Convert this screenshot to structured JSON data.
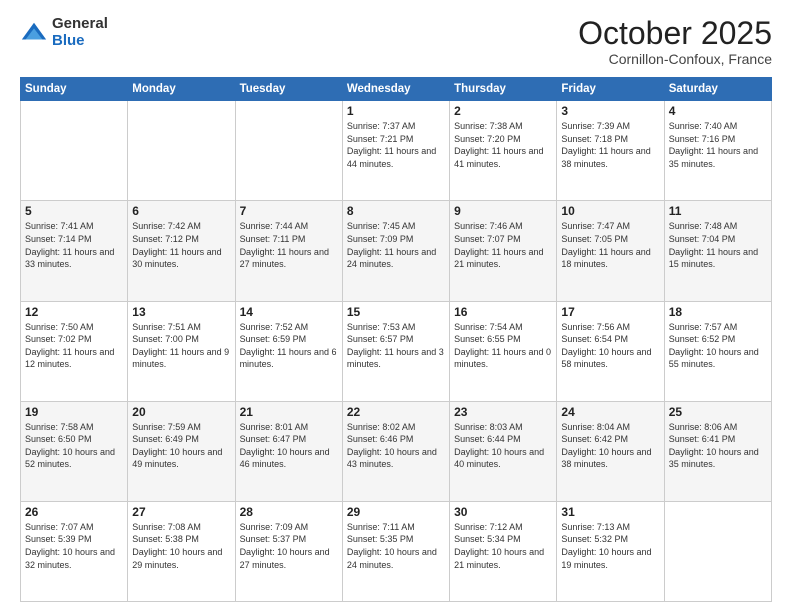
{
  "header": {
    "logo": {
      "general": "General",
      "blue": "Blue"
    },
    "title": "October 2025",
    "location": "Cornillon-Confoux, France"
  },
  "days_of_week": [
    "Sunday",
    "Monday",
    "Tuesday",
    "Wednesday",
    "Thursday",
    "Friday",
    "Saturday"
  ],
  "weeks": [
    [
      {
        "day": "",
        "sunrise": "",
        "sunset": "",
        "daylight": ""
      },
      {
        "day": "",
        "sunrise": "",
        "sunset": "",
        "daylight": ""
      },
      {
        "day": "",
        "sunrise": "",
        "sunset": "",
        "daylight": ""
      },
      {
        "day": "1",
        "sunrise": "Sunrise: 7:37 AM",
        "sunset": "Sunset: 7:21 PM",
        "daylight": "Daylight: 11 hours and 44 minutes."
      },
      {
        "day": "2",
        "sunrise": "Sunrise: 7:38 AM",
        "sunset": "Sunset: 7:20 PM",
        "daylight": "Daylight: 11 hours and 41 minutes."
      },
      {
        "day": "3",
        "sunrise": "Sunrise: 7:39 AM",
        "sunset": "Sunset: 7:18 PM",
        "daylight": "Daylight: 11 hours and 38 minutes."
      },
      {
        "day": "4",
        "sunrise": "Sunrise: 7:40 AM",
        "sunset": "Sunset: 7:16 PM",
        "daylight": "Daylight: 11 hours and 35 minutes."
      }
    ],
    [
      {
        "day": "5",
        "sunrise": "Sunrise: 7:41 AM",
        "sunset": "Sunset: 7:14 PM",
        "daylight": "Daylight: 11 hours and 33 minutes."
      },
      {
        "day": "6",
        "sunrise": "Sunrise: 7:42 AM",
        "sunset": "Sunset: 7:12 PM",
        "daylight": "Daylight: 11 hours and 30 minutes."
      },
      {
        "day": "7",
        "sunrise": "Sunrise: 7:44 AM",
        "sunset": "Sunset: 7:11 PM",
        "daylight": "Daylight: 11 hours and 27 minutes."
      },
      {
        "day": "8",
        "sunrise": "Sunrise: 7:45 AM",
        "sunset": "Sunset: 7:09 PM",
        "daylight": "Daylight: 11 hours and 24 minutes."
      },
      {
        "day": "9",
        "sunrise": "Sunrise: 7:46 AM",
        "sunset": "Sunset: 7:07 PM",
        "daylight": "Daylight: 11 hours and 21 minutes."
      },
      {
        "day": "10",
        "sunrise": "Sunrise: 7:47 AM",
        "sunset": "Sunset: 7:05 PM",
        "daylight": "Daylight: 11 hours and 18 minutes."
      },
      {
        "day": "11",
        "sunrise": "Sunrise: 7:48 AM",
        "sunset": "Sunset: 7:04 PM",
        "daylight": "Daylight: 11 hours and 15 minutes."
      }
    ],
    [
      {
        "day": "12",
        "sunrise": "Sunrise: 7:50 AM",
        "sunset": "Sunset: 7:02 PM",
        "daylight": "Daylight: 11 hours and 12 minutes."
      },
      {
        "day": "13",
        "sunrise": "Sunrise: 7:51 AM",
        "sunset": "Sunset: 7:00 PM",
        "daylight": "Daylight: 11 hours and 9 minutes."
      },
      {
        "day": "14",
        "sunrise": "Sunrise: 7:52 AM",
        "sunset": "Sunset: 6:59 PM",
        "daylight": "Daylight: 11 hours and 6 minutes."
      },
      {
        "day": "15",
        "sunrise": "Sunrise: 7:53 AM",
        "sunset": "Sunset: 6:57 PM",
        "daylight": "Daylight: 11 hours and 3 minutes."
      },
      {
        "day": "16",
        "sunrise": "Sunrise: 7:54 AM",
        "sunset": "Sunset: 6:55 PM",
        "daylight": "Daylight: 11 hours and 0 minutes."
      },
      {
        "day": "17",
        "sunrise": "Sunrise: 7:56 AM",
        "sunset": "Sunset: 6:54 PM",
        "daylight": "Daylight: 10 hours and 58 minutes."
      },
      {
        "day": "18",
        "sunrise": "Sunrise: 7:57 AM",
        "sunset": "Sunset: 6:52 PM",
        "daylight": "Daylight: 10 hours and 55 minutes."
      }
    ],
    [
      {
        "day": "19",
        "sunrise": "Sunrise: 7:58 AM",
        "sunset": "Sunset: 6:50 PM",
        "daylight": "Daylight: 10 hours and 52 minutes."
      },
      {
        "day": "20",
        "sunrise": "Sunrise: 7:59 AM",
        "sunset": "Sunset: 6:49 PM",
        "daylight": "Daylight: 10 hours and 49 minutes."
      },
      {
        "day": "21",
        "sunrise": "Sunrise: 8:01 AM",
        "sunset": "Sunset: 6:47 PM",
        "daylight": "Daylight: 10 hours and 46 minutes."
      },
      {
        "day": "22",
        "sunrise": "Sunrise: 8:02 AM",
        "sunset": "Sunset: 6:46 PM",
        "daylight": "Daylight: 10 hours and 43 minutes."
      },
      {
        "day": "23",
        "sunrise": "Sunrise: 8:03 AM",
        "sunset": "Sunset: 6:44 PM",
        "daylight": "Daylight: 10 hours and 40 minutes."
      },
      {
        "day": "24",
        "sunrise": "Sunrise: 8:04 AM",
        "sunset": "Sunset: 6:42 PM",
        "daylight": "Daylight: 10 hours and 38 minutes."
      },
      {
        "day": "25",
        "sunrise": "Sunrise: 8:06 AM",
        "sunset": "Sunset: 6:41 PM",
        "daylight": "Daylight: 10 hours and 35 minutes."
      }
    ],
    [
      {
        "day": "26",
        "sunrise": "Sunrise: 7:07 AM",
        "sunset": "Sunset: 5:39 PM",
        "daylight": "Daylight: 10 hours and 32 minutes."
      },
      {
        "day": "27",
        "sunrise": "Sunrise: 7:08 AM",
        "sunset": "Sunset: 5:38 PM",
        "daylight": "Daylight: 10 hours and 29 minutes."
      },
      {
        "day": "28",
        "sunrise": "Sunrise: 7:09 AM",
        "sunset": "Sunset: 5:37 PM",
        "daylight": "Daylight: 10 hours and 27 minutes."
      },
      {
        "day": "29",
        "sunrise": "Sunrise: 7:11 AM",
        "sunset": "Sunset: 5:35 PM",
        "daylight": "Daylight: 10 hours and 24 minutes."
      },
      {
        "day": "30",
        "sunrise": "Sunrise: 7:12 AM",
        "sunset": "Sunset: 5:34 PM",
        "daylight": "Daylight: 10 hours and 21 minutes."
      },
      {
        "day": "31",
        "sunrise": "Sunrise: 7:13 AM",
        "sunset": "Sunset: 5:32 PM",
        "daylight": "Daylight: 10 hours and 19 minutes."
      },
      {
        "day": "",
        "sunrise": "",
        "sunset": "",
        "daylight": ""
      }
    ]
  ]
}
